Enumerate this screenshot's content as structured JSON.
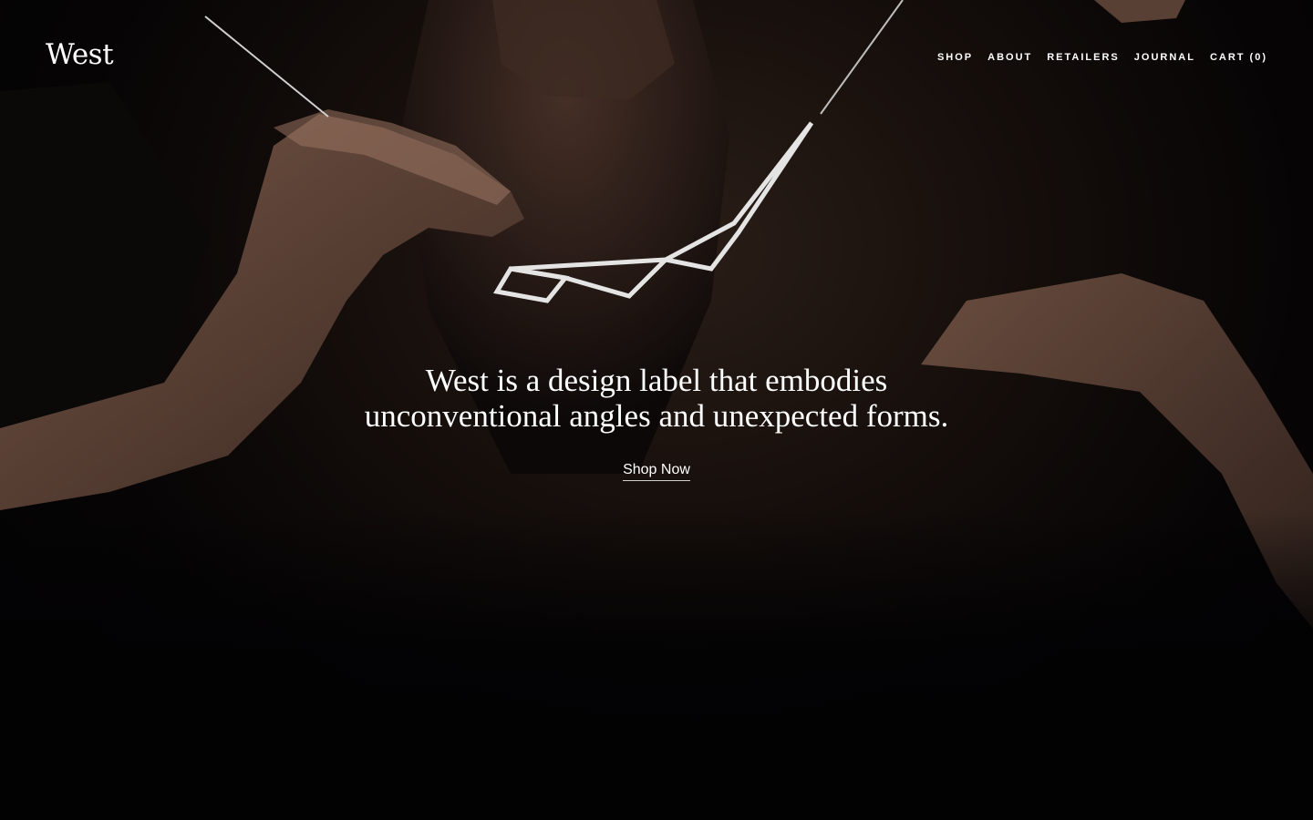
{
  "header": {
    "logo": "West",
    "nav": [
      {
        "label": "SHOP"
      },
      {
        "label": "ABOUT"
      },
      {
        "label": "RETAILERS"
      },
      {
        "label": "JOURNAL"
      },
      {
        "label": "CART (0)"
      }
    ]
  },
  "hero": {
    "headline_line1": "West is a design label that embodies",
    "headline_line2": "unconventional angles and unexpected forms.",
    "cta_label": "Shop Now",
    "image_icon": "model-wearing-geometric-necklace-photo"
  },
  "colors": {
    "background": "#030203",
    "text": "#ffffff",
    "skin_tone": "#7a5a48"
  }
}
